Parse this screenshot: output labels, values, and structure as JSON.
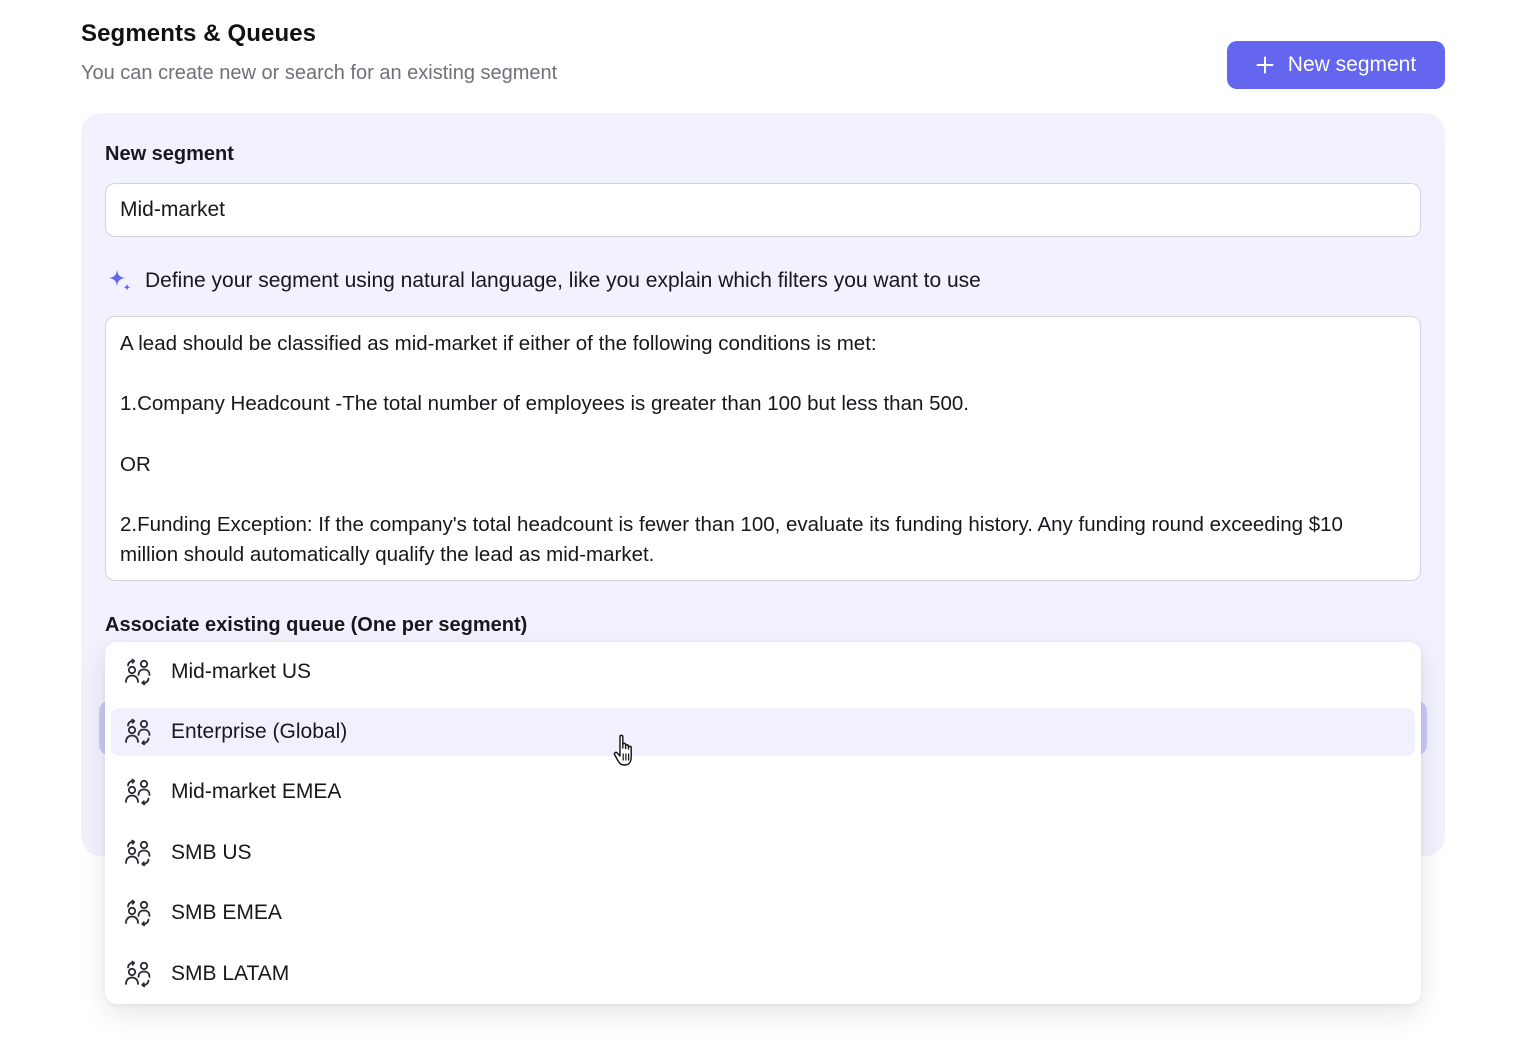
{
  "header": {
    "title": "Segments & Queues",
    "subtitle": "You can create new or search for an existing segment",
    "new_button_label": "New segment",
    "new_button_icon": "plus-icon",
    "accent_color": "#6466ef"
  },
  "form": {
    "name_label": "New segment",
    "name_value": "Mid-market",
    "define_icon": "sparkle-icon",
    "define_label": "Define your segment using natural language, like you explain which filters you want to use",
    "definition_lines": [
      "A lead should be classified as mid-market if either of the following conditions is met:",
      "1.Company Headcount -The total number of employees is greater than 100 but less than 500.",
      "OR",
      "2.Funding Exception: If the company's total headcount is fewer than 100, evaluate its funding history. Any funding round exceeding $10 million should automatically qualify the lead as mid-market."
    ],
    "queue_label": "Associate existing queue (One per segment)"
  },
  "dropdown": {
    "option_icon": "queue-icon",
    "hovered_option": "Enterprise (Global)",
    "options": [
      {
        "label": "Mid-market US"
      },
      {
        "label": "Enterprise (Global)"
      },
      {
        "label": "Mid-market EMEA"
      },
      {
        "label": "SMB US"
      },
      {
        "label": "SMB EMEA"
      },
      {
        "label": "SMB LATAM"
      }
    ]
  }
}
